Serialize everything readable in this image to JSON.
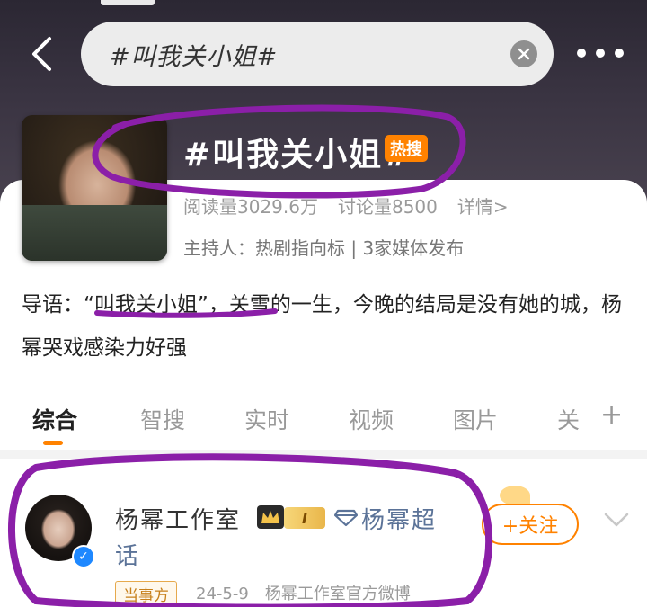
{
  "header": {
    "search_value": "#叫我关小姐#",
    "back_icon": "chevron-left-icon",
    "clear_icon": "clear-circle-icon",
    "more_icon": "more-dots-icon"
  },
  "topic": {
    "title": "#叫我关小姐#",
    "hot_badge": "热搜",
    "reads": "阅读量3029.6万",
    "discussions": "讨论量8500",
    "details_link": "详情>",
    "host": "主持人：热剧指向标 | 3家媒体发布",
    "guide": "导语：“叫我关小姐”，关雪的一生，今晚的结局是没有她的城，杨幂哭戏感染力好强"
  },
  "tabs": [
    {
      "label": "综合"
    },
    {
      "label": "智搜"
    },
    {
      "label": "实时"
    },
    {
      "label": "视频"
    },
    {
      "label": "图片"
    },
    {
      "label": "关"
    }
  ],
  "tab_plus": "+",
  "post": {
    "author": "杨幂工作室",
    "level": "I",
    "super_topic_part1": "杨幂超",
    "super_topic_part2": "话",
    "follow_label": "+关注",
    "tag": "当事方",
    "date": "24-5-9",
    "source": "杨幂工作室官方微博"
  },
  "colors": {
    "accent": "#ff8200",
    "annotation": "#8b1fa8",
    "link": "#5b7398"
  }
}
